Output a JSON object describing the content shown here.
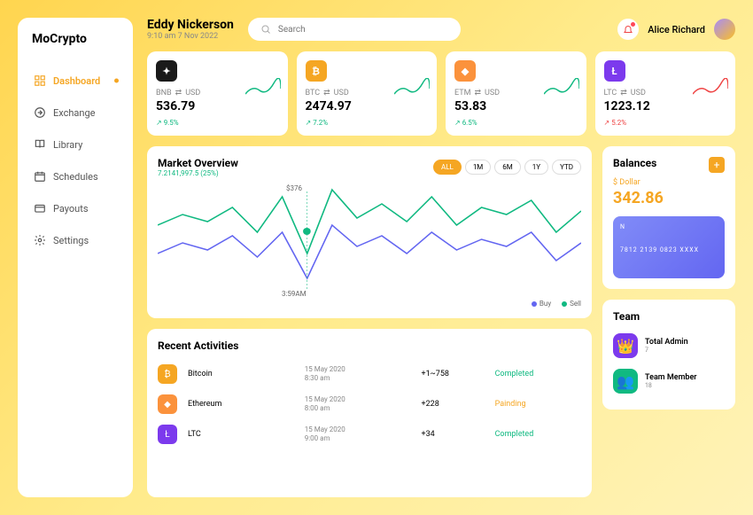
{
  "logo": "MoCrypto",
  "nav": [
    {
      "label": "Dashboard",
      "icon": "grid"
    },
    {
      "label": "Exchange",
      "icon": "exchange"
    },
    {
      "label": "Library",
      "icon": "book"
    },
    {
      "label": "Schedules",
      "icon": "calendar"
    },
    {
      "label": "Payouts",
      "icon": "wallet"
    },
    {
      "label": "Settings",
      "icon": "gear"
    }
  ],
  "header": {
    "name": "Eddy Nickerson",
    "time": "9:10 am 7 Nov 2022",
    "searchPlaceholder": "Search",
    "username": "Alice Richard"
  },
  "coins": [
    {
      "sym": "BNB",
      "quote": "USD",
      "price": "536.79",
      "change": "9.5%",
      "dir": "up",
      "bg": "#1a1a1a",
      "glyph": "✦",
      "spark": "#10b981"
    },
    {
      "sym": "BTC",
      "quote": "USD",
      "price": "2474.97",
      "change": "7.2%",
      "dir": "up",
      "bg": "#f5a623",
      "glyph": "₿",
      "spark": "#10b981"
    },
    {
      "sym": "ETM",
      "quote": "USD",
      "price": "53.83",
      "change": "6.5%",
      "dir": "up",
      "bg": "#fb923c",
      "glyph": "◆",
      "spark": "#10b981"
    },
    {
      "sym": "LTC",
      "quote": "USD",
      "price": "1223.12",
      "change": "5.2%",
      "dir": "down",
      "bg": "#7c3aed",
      "glyph": "Ł",
      "spark": "#ef4444"
    }
  ],
  "market": {
    "title": "Market Overview",
    "sub": "7.2141,997.5 (25%)",
    "filters": [
      "ALL",
      "1M",
      "6M",
      "1Y",
      "YTD"
    ],
    "activeFilter": "ALL",
    "tooltip": "$376",
    "timeLabel": "3:59AM",
    "legend": {
      "buy": "Buy",
      "sell": "Sell"
    }
  },
  "chart_data": {
    "type": "line",
    "series": [
      {
        "name": "Sell",
        "color": "#10b981",
        "values": [
          280,
          310,
          290,
          330,
          260,
          360,
          200,
          380,
          300,
          340,
          290,
          360,
          280,
          330,
          310,
          350,
          260,
          320
        ]
      },
      {
        "name": "Buy",
        "color": "#6366f1",
        "values": [
          200,
          230,
          210,
          250,
          190,
          260,
          130,
          280,
          220,
          250,
          200,
          260,
          210,
          240,
          220,
          260,
          180,
          230
        ]
      }
    ],
    "tooltip_point": {
      "x": 6,
      "value": 376
    },
    "xlabel": "3:59AM",
    "ylim": [
      100,
      400
    ]
  },
  "activities": {
    "title": "Recent Activities",
    "rows": [
      {
        "coin": "Bitcoin",
        "bg": "#f5a623",
        "glyph": "₿",
        "date": "15 May 2020",
        "time": "8:30 am",
        "amount": "+1~758",
        "status": "Completed",
        "statusClass": "c"
      },
      {
        "coin": "Ethereum",
        "bg": "#fb923c",
        "glyph": "◆",
        "date": "15 May 2020",
        "time": "8:00 am",
        "amount": "+228",
        "status": "Painding",
        "statusClass": "p"
      },
      {
        "coin": "LTC",
        "bg": "#7c3aed",
        "glyph": "Ł",
        "date": "15 May 2020",
        "time": "9:00 am",
        "amount": "+34",
        "status": "Completed",
        "statusClass": "c"
      }
    ]
  },
  "balances": {
    "title": "Balances",
    "currency": "$ Dollar",
    "amount": "342.86",
    "card": {
      "holder": "N",
      "number": "7812 2139 0823 XXXX"
    }
  },
  "team": {
    "title": "Team",
    "items": [
      {
        "label": "Total Admin",
        "count": "7",
        "bg": "#7c3aed",
        "glyph": "👑"
      },
      {
        "label": "Team Member",
        "count": "18",
        "bg": "#10b981",
        "glyph": "👥"
      }
    ]
  }
}
